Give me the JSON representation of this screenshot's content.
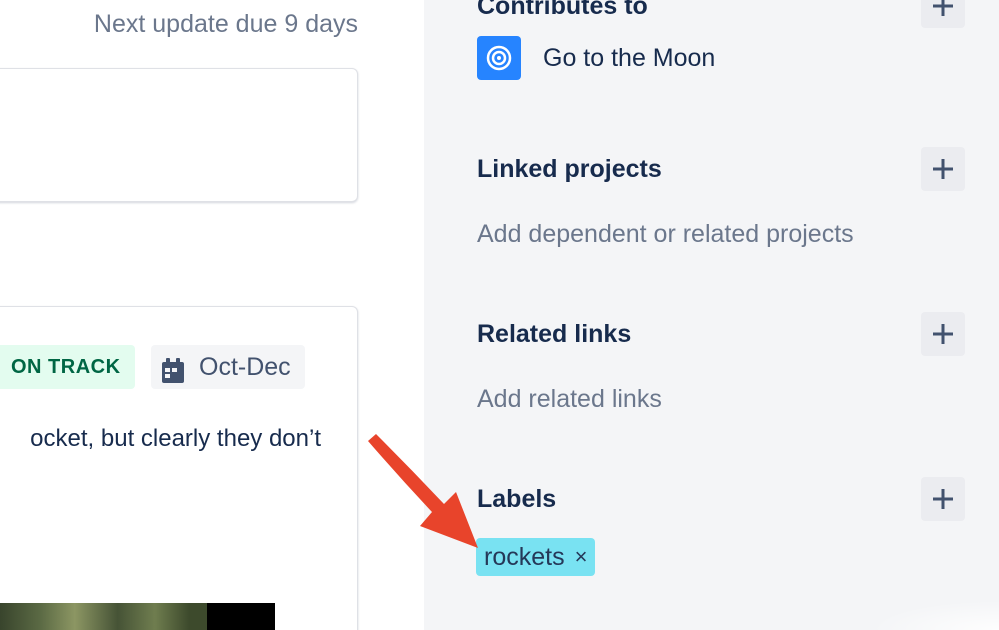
{
  "main": {
    "next_update": "Next update due 9 days",
    "status": {
      "lozenge": "ON TRACK",
      "target_date": "Oct-Dec",
      "text": "ocket, but clearly they don’t"
    }
  },
  "sidebar": {
    "contributes": {
      "title": "Contributes to",
      "goal_name": "Go to the Moon"
    },
    "linked_projects": {
      "title": "Linked projects",
      "placeholder": "Add dependent or related projects"
    },
    "related_links": {
      "title": "Related links",
      "placeholder": "Add related links"
    },
    "labels": {
      "title": "Labels",
      "items": [
        {
          "label": "rockets",
          "remove": "×"
        }
      ]
    }
  },
  "colors": {
    "accent_blue": "#2684ff",
    "on_track_bg": "#e3fcef",
    "on_track_text": "#006644",
    "label_bg": "#79e2f2",
    "annotation_arrow": "#e8442b"
  }
}
